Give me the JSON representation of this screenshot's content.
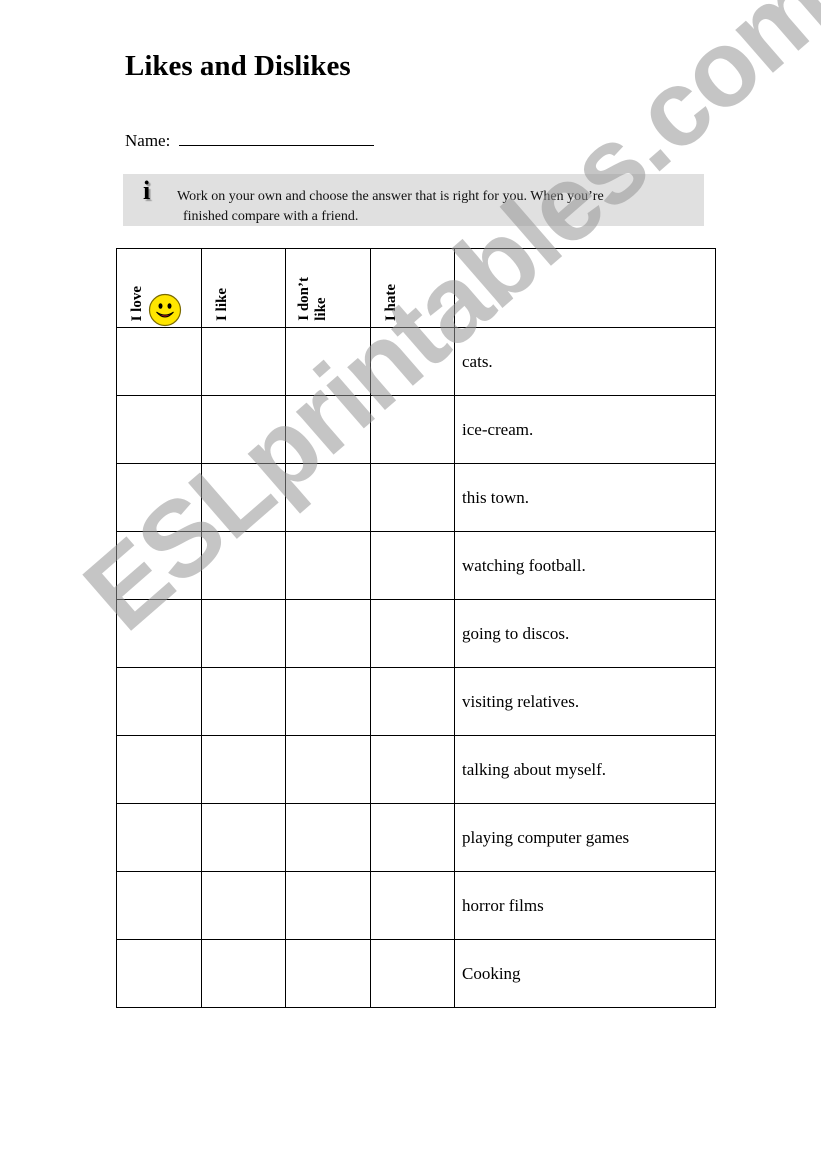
{
  "worksheet": {
    "title": "Likes and Dislikes",
    "name_label": "Name:",
    "info": {
      "icon": "info-icon",
      "icon_glyph": "i",
      "line1": "Work on your own and choose the answer that is right for you. When you’re",
      "line2": "finished compare with a friend."
    },
    "table": {
      "headers": [
        "I love",
        "I like",
        "I don’t\nlike",
        "I hate",
        ""
      ],
      "rows": [
        "cats.",
        "ice-cream.",
        "this town.",
        "watching football.",
        "going to discos.",
        "visiting relatives.",
        "talking about myself.",
        "playing computer games",
        "horror films",
        "Cooking"
      ]
    },
    "watermark": "ESLprintables.com",
    "colors": {
      "info_bg": "#e0e0e0",
      "smiley_fill": "#ffe600",
      "watermark": "#a0a0a0"
    }
  }
}
